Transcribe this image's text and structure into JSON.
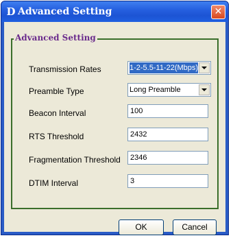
{
  "window": {
    "title": "Advanced Setting",
    "app_icon": "D",
    "close_glyph": "✕"
  },
  "group": {
    "legend": "Advanced Setting"
  },
  "fields": {
    "transmission_rates": {
      "label": "Transmission Rates",
      "value": "1-2-5.5-11-22(Mbps)"
    },
    "preamble_type": {
      "label": "Preamble Type",
      "value": "Long Preamble"
    },
    "beacon_interval": {
      "label": "Beacon Interval",
      "value": "100"
    },
    "rts_threshold": {
      "label": "RTS Threshold",
      "value": "2432"
    },
    "fragmentation_threshold": {
      "label": "Fragmentation Threshold",
      "value": "2346"
    },
    "dtim_interval": {
      "label": "DTIM Interval",
      "value": "3"
    }
  },
  "buttons": {
    "ok": "OK",
    "cancel": "Cancel"
  },
  "colors": {
    "title_bar": "#2660e0",
    "close_button": "#d8491f",
    "group_border": "#3a6e2a",
    "legend_text": "#6a2b8c",
    "selection": "#316ac5",
    "dialog_face": "#ece9d8"
  },
  "icons": {
    "app": "app-logo-icon",
    "close": "close-icon",
    "dropdown": "chevron-down-icon"
  }
}
